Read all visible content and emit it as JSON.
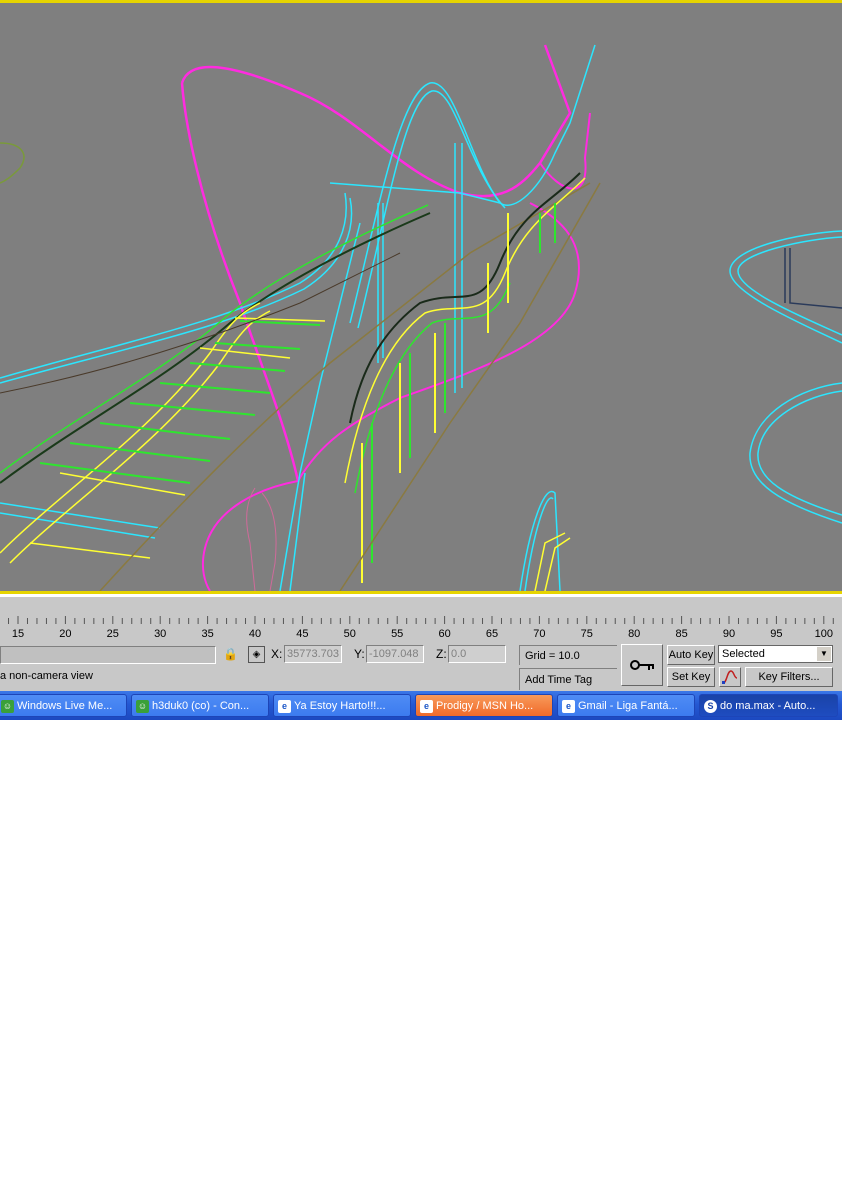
{
  "viewport": {
    "bg_color": "#7f7f7f",
    "border_color": "#e6d400"
  },
  "timeline": {
    "tick_labels": [
      "15",
      "20",
      "25",
      "30",
      "35",
      "40",
      "45",
      "50",
      "55",
      "60",
      "65",
      "70",
      "75",
      "80",
      "85",
      "90",
      "95",
      "100"
    ]
  },
  "status": {
    "prompt_text": "a non-camera view",
    "x_label": "X:",
    "x_value": "35773.703",
    "y_label": "Y:",
    "y_value": "-1097.048",
    "z_label": "Z:",
    "z_value": "0.0",
    "grid_text": "Grid = 10.0",
    "add_time_tag": "Add Time Tag",
    "auto_key": "Auto Key",
    "set_key": "Set Key",
    "selected_option": "Selected",
    "key_filters": "Key Filters..."
  },
  "taskbar": {
    "items": [
      {
        "label": "Windows Live Me..."
      },
      {
        "label": "h3duk0 (co) - Con..."
      },
      {
        "label": "Ya Estoy Harto!!!..."
      },
      {
        "label": "Prodigy / MSN Ho..."
      },
      {
        "label": "Gmail - Liga Fantá..."
      },
      {
        "label": "do ma.max - Auto..."
      }
    ]
  }
}
